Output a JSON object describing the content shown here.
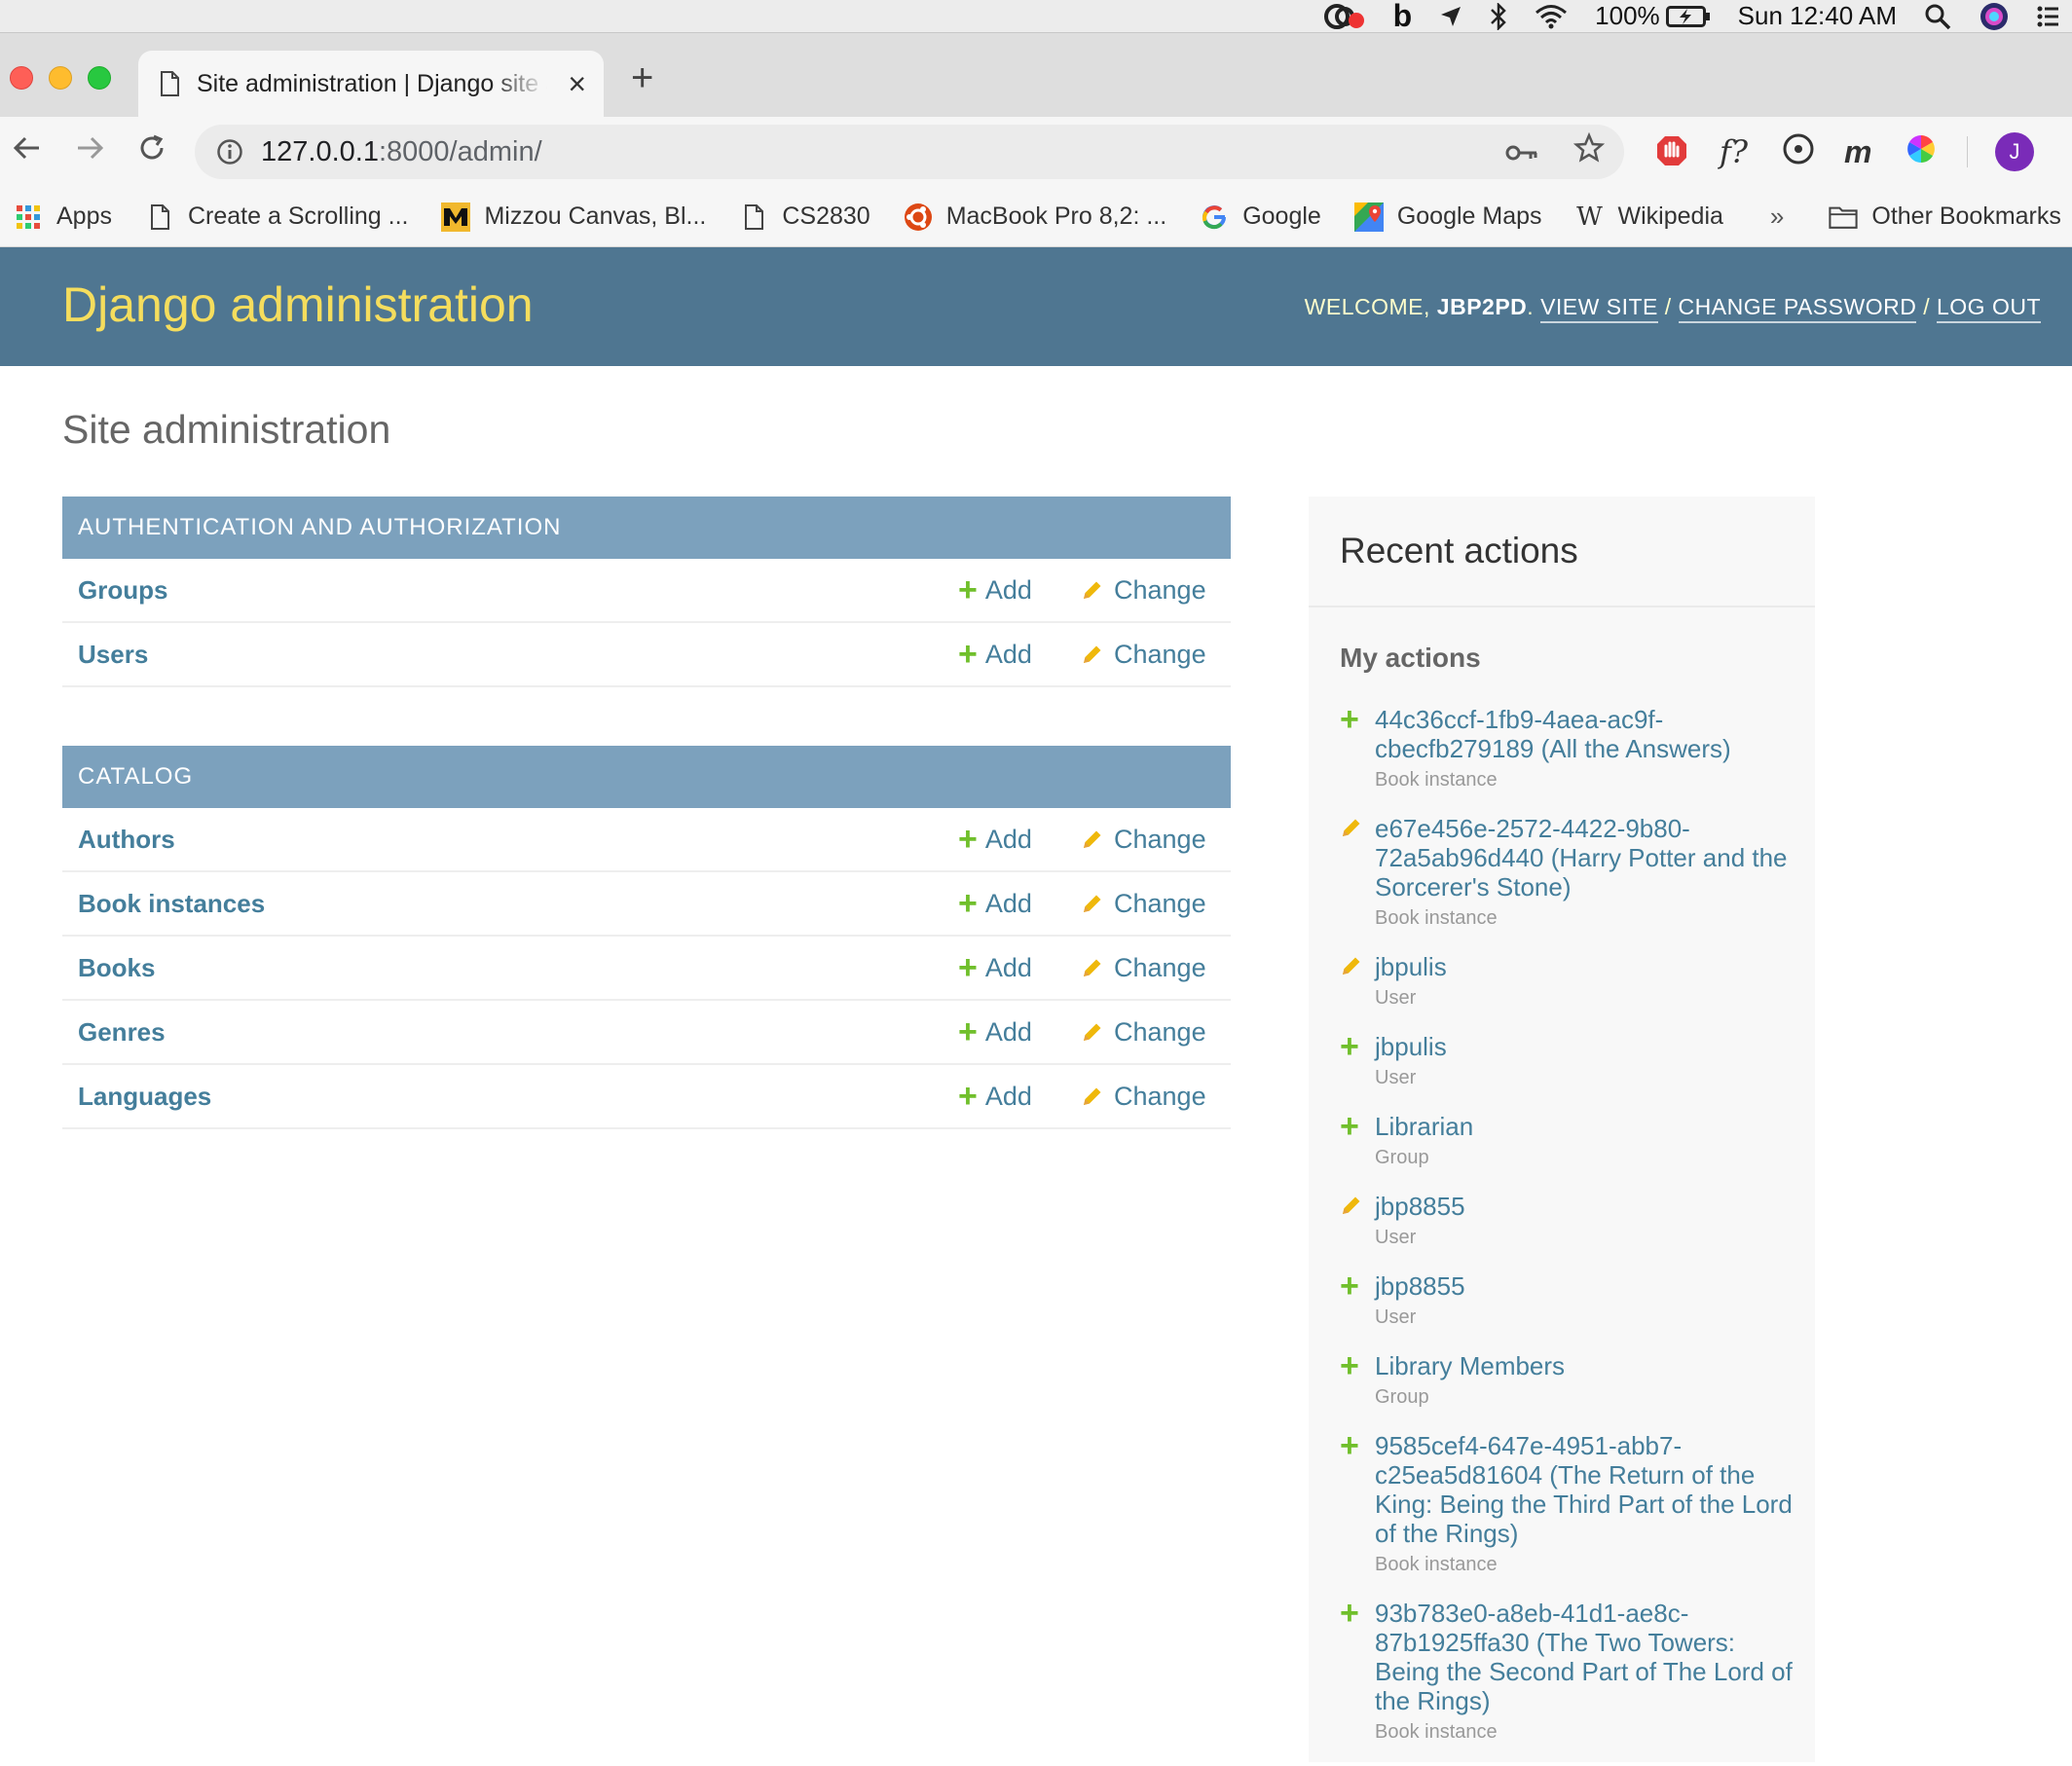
{
  "menubar": {
    "battery": "100%",
    "clock": "Sun 12:40 AM"
  },
  "browser": {
    "tab_title": "Site administration | Django site admin",
    "url_host": "127.0.0.1",
    "url_path": ":8000/admin/",
    "profile_initial": "J",
    "bookmarks": [
      {
        "label": "Apps",
        "icon": "apps-grid-icon"
      },
      {
        "label": "Create a Scrolling ...",
        "icon": "page-icon"
      },
      {
        "label": "Mizzou Canvas, Bl...",
        "icon": "mizzou-logo-icon"
      },
      {
        "label": "CS2830",
        "icon": "page-icon"
      },
      {
        "label": "MacBook Pro 8,2: ...",
        "icon": "ubuntu-icon"
      },
      {
        "label": "Google",
        "icon": "google-icon"
      },
      {
        "label": "Google Maps",
        "icon": "maps-icon"
      },
      {
        "label": "Wikipedia",
        "icon": "wikipedia-icon"
      }
    ],
    "bookmarks_overflow": "»",
    "other_bookmarks": "Other Bookmarks"
  },
  "header": {
    "branding": "Django administration",
    "welcome": "Welcome,",
    "username": "jbp2pd",
    "view_site": "View site",
    "change_password": "Change password",
    "log_out": "Log out"
  },
  "page_title": "Site administration",
  "apps": [
    {
      "caption": "Authentication and Authorization",
      "models": [
        {
          "name": "Groups",
          "add": "Add",
          "change": "Change"
        },
        {
          "name": "Users",
          "add": "Add",
          "change": "Change"
        }
      ]
    },
    {
      "caption": "Catalog",
      "models": [
        {
          "name": "Authors",
          "add": "Add",
          "change": "Change"
        },
        {
          "name": "Book instances",
          "add": "Add",
          "change": "Change"
        },
        {
          "name": "Books",
          "add": "Add",
          "change": "Change"
        },
        {
          "name": "Genres",
          "add": "Add",
          "change": "Change"
        },
        {
          "name": "Languages",
          "add": "Add",
          "change": "Change"
        }
      ]
    }
  ],
  "recent": {
    "title": "Recent actions",
    "subtitle": "My actions",
    "actions": [
      {
        "kind": "add",
        "text": "44c36ccf-1fb9-4aea-ac9f-cbecfb279189 (All the Answers)",
        "type": "Book instance"
      },
      {
        "kind": "change",
        "text": "e67e456e-2572-4422-9b80-72a5ab96d440 (Harry Potter and the Sorcerer's Stone)",
        "type": "Book instance"
      },
      {
        "kind": "change",
        "text": "jbpulis",
        "type": "User"
      },
      {
        "kind": "add",
        "text": "jbpulis",
        "type": "User"
      },
      {
        "kind": "add",
        "text": "Librarian",
        "type": "Group"
      },
      {
        "kind": "change",
        "text": "jbp8855",
        "type": "User"
      },
      {
        "kind": "add",
        "text": "jbp8855",
        "type": "User"
      },
      {
        "kind": "add",
        "text": "Library Members",
        "type": "Group"
      },
      {
        "kind": "add",
        "text": "9585cef4-647e-4951-abb7-c25ea5d81604 (The Return of the King: Being the Third Part of the Lord of the Rings)",
        "type": "Book instance"
      },
      {
        "kind": "add",
        "text": "93b783e0-a8eb-41d1-ae8c-87b1925ffa30 (The Two Towers: Being the Second Part of The Lord of the Rings)",
        "type": "Book instance"
      }
    ]
  },
  "colors": {
    "header_bg": "#4f7691",
    "branding": "#f5dd5d",
    "caption_bg": "#7ca1bd",
    "link": "#447e9b",
    "add_green": "#70bf2b",
    "change_yellow": "#efb80b"
  }
}
